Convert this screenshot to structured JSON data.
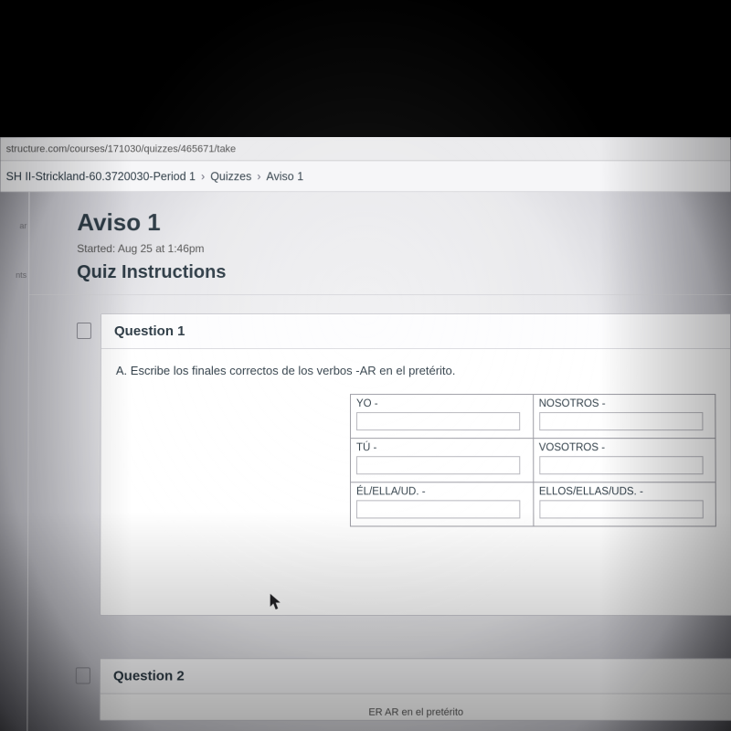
{
  "url": "structure.com/courses/171030/quizzes/465671/take",
  "breadcrumbs": {
    "course": "SH II-Strickland-60.3720030-Period 1",
    "section": "Quizzes",
    "item": "Aviso 1"
  },
  "leftnav": {
    "item1": "ar",
    "item2": "nts"
  },
  "quiz": {
    "title": "Aviso 1",
    "started": "Started: Aug 25 at 1:46pm",
    "instructions_heading": "Quiz Instructions"
  },
  "question1": {
    "header": "Question 1",
    "prompt": "A. Escribe los finales correctos de los verbos -AR en el pretérito.",
    "cells": {
      "yo": "YO -",
      "nosotros": "NOSOTROS -",
      "tu": "TÚ -",
      "vosotros": "VOSOTROS -",
      "el": "ÉL/ELLA/UD. -",
      "ellos": "ELLOS/ELLAS/UDS. -"
    }
  },
  "question2": {
    "header": "Question 2",
    "partial": "ER AR en el pretérito"
  }
}
